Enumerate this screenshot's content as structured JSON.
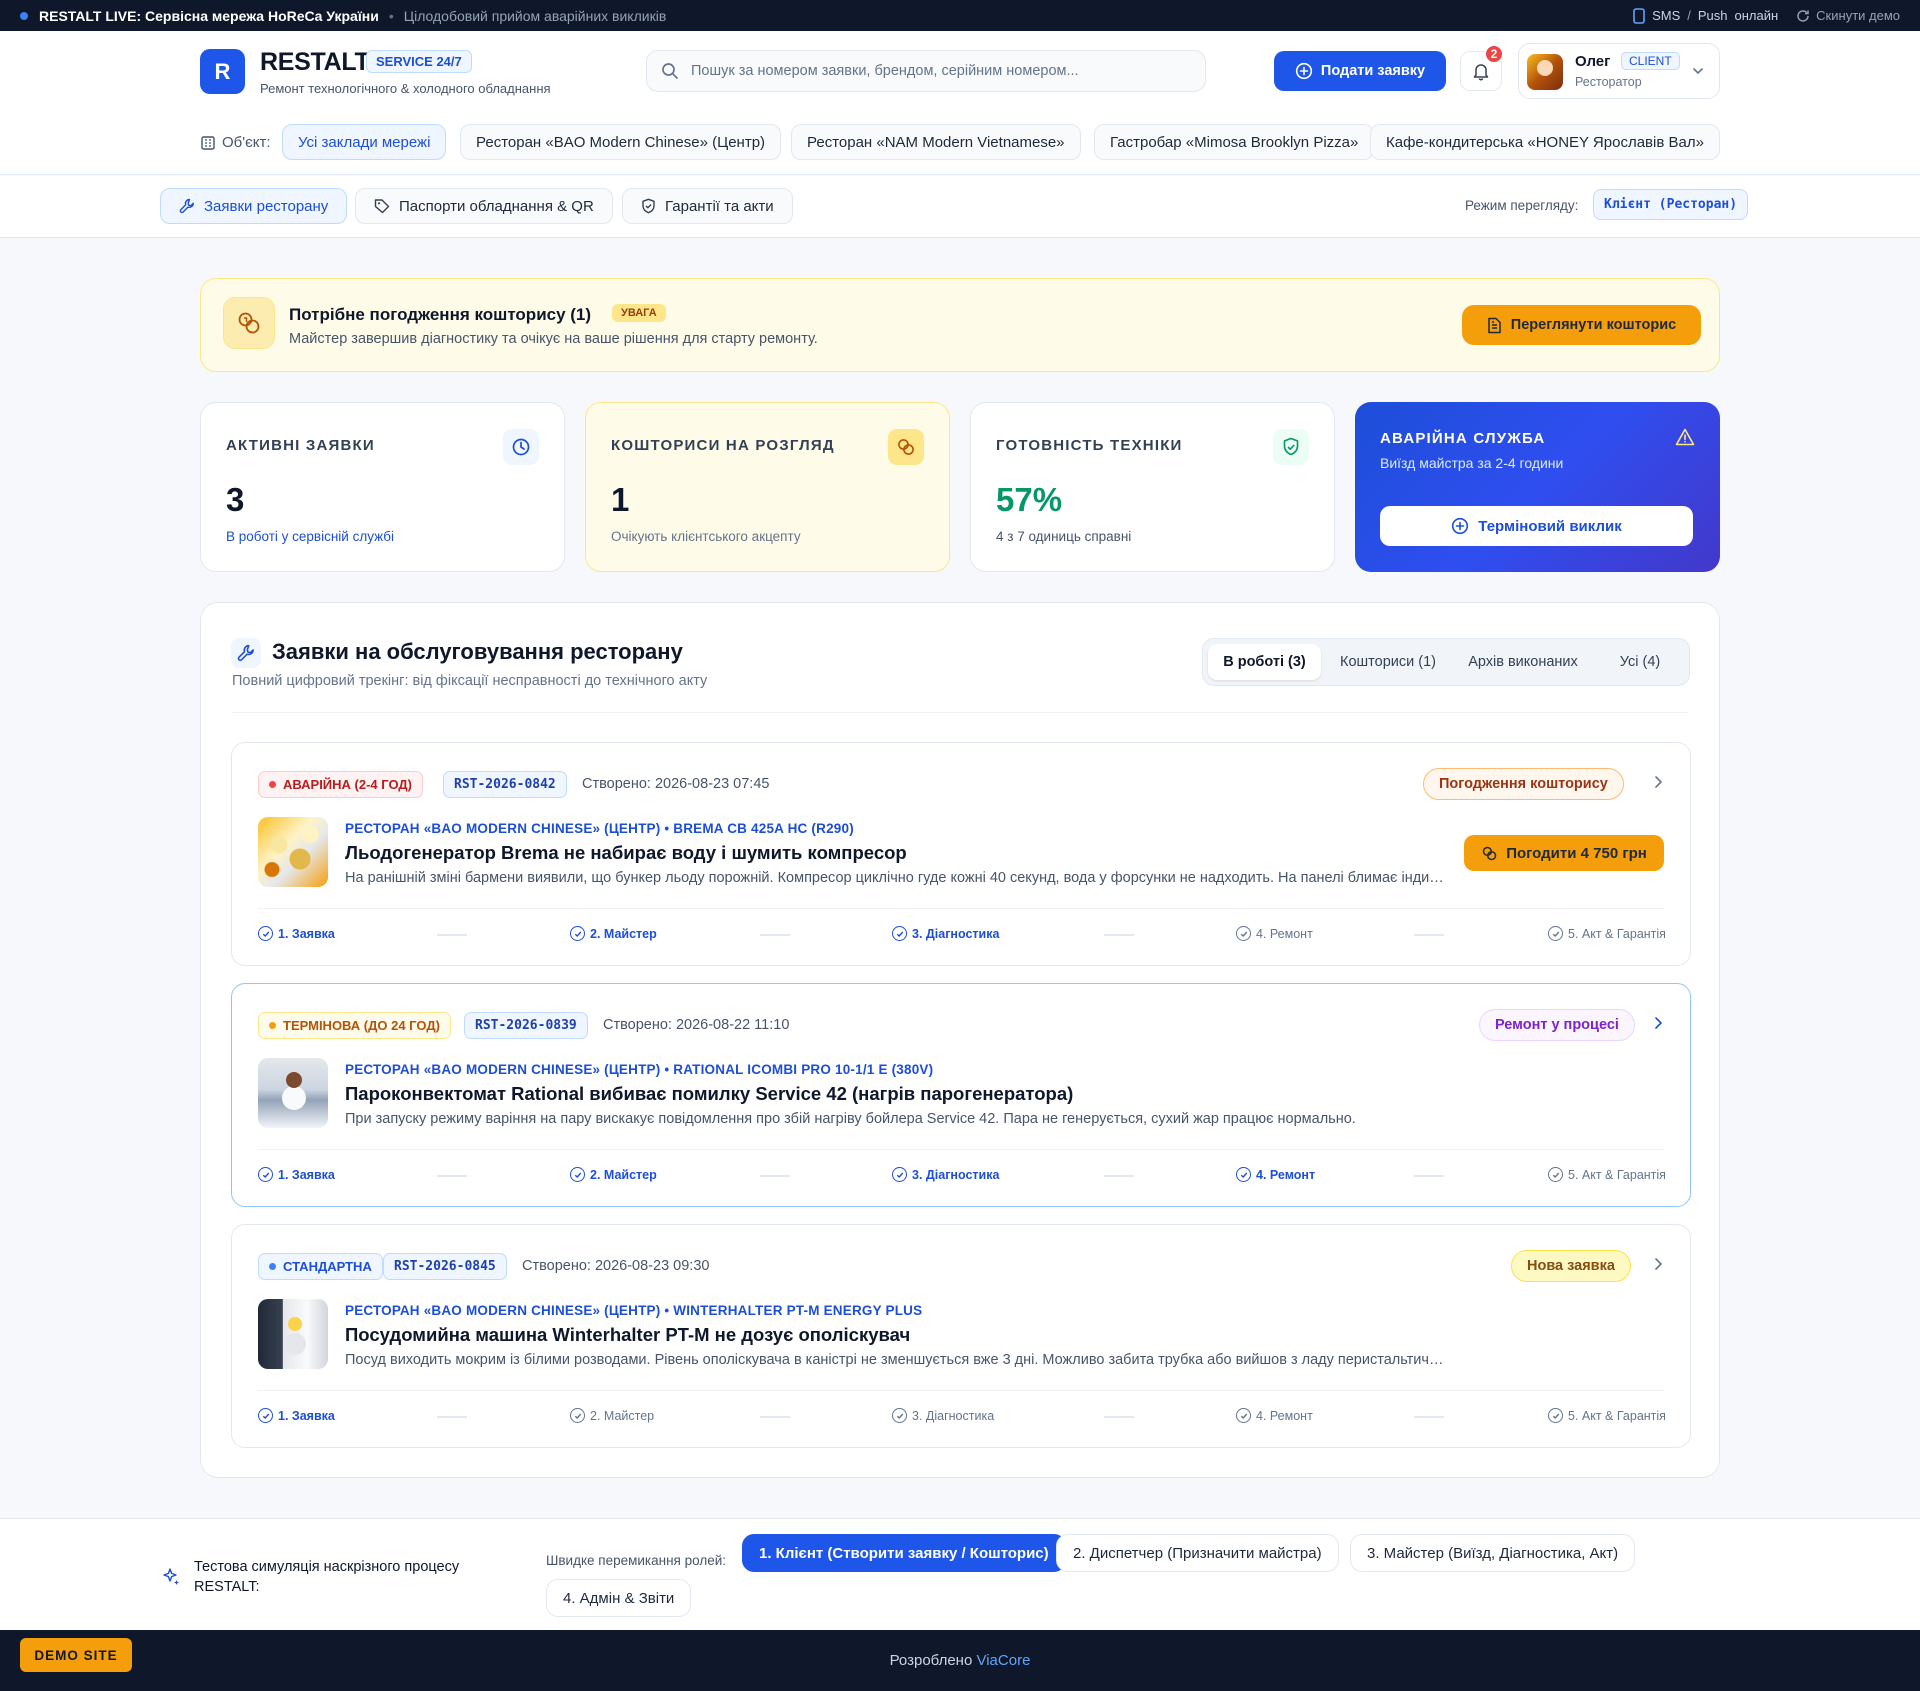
{
  "topbar": {
    "live": "RESTALT LIVE: Сервісна мережа HoReCa України",
    "sep": "•",
    "sub": "Цілодобовий прийом аварійних викликів",
    "sms": "SMS",
    "slash": "/",
    "push": "Push",
    "online": "онлайн",
    "reset": "Скинути демо"
  },
  "header": {
    "logo_letter": "R",
    "brand": "RESTALT",
    "brand_tag": "SERVICE 24/7",
    "brand_sub": "Ремонт технологічного & холодного обладнання",
    "search_placeholder": "Пошук за номером заявки, брендом, серійним номером...",
    "submit_label": "Подати заявку",
    "notifications_count": "2",
    "user": {
      "name": "Олег",
      "tag": "CLIENT",
      "role": "Ресторатор"
    },
    "object_label": "Об'єкт:",
    "objects": [
      "Усі заклади мережі",
      "Ресторан «BAO Modern Chinese» (Центр)",
      "Ресторан «NAM Modern Vietnamese»",
      "Гастробар «Mimosa Brooklyn Pizza»",
      "Кафе-кондитерська «HONEY Ярославів Вал»"
    ]
  },
  "nav": {
    "tabs": [
      "Заявки ресторану",
      "Паспорти обладнання & QR",
      "Гарантії та акти"
    ],
    "mode_label": "Режим перегляду:",
    "mode_value": "Клієнт (Ресторан)"
  },
  "alert": {
    "title": "Потрібне погодження кошторису (1)",
    "badge": "УВАГА",
    "desc": "Майстер завершив діагностику та очікує на ваше рішення для старту ремонту.",
    "button": "Переглянути кошторис"
  },
  "stats": [
    {
      "label": "АКТИВНІ ЗАЯВКИ",
      "value": "3",
      "note": "В роботі у сервісній службі"
    },
    {
      "label": "КОШТОРИСИ НА РОЗГЛЯД",
      "value": "1",
      "note": "Очікують клієнтського акцепту"
    },
    {
      "label": "ГОТОВНІСТЬ ТЕХНІКИ",
      "value": "57%",
      "note": "4 з 7 одиниць справні"
    },
    {
      "label": "АВАРІЙНА СЛУЖБА",
      "note": "Виїзд майстра за 2-4 години",
      "button": "Терміновий виклик"
    }
  ],
  "colors": {
    "accent": "#1d56e8",
    "amber": "#f59e0b",
    "success": "#059669",
    "danger": "#ef4444"
  },
  "main": {
    "title": "Заявки на обслуговування ресторану",
    "subtitle": "Повний цифровий трекінг: від фіксації несправності до технічного акту",
    "filters": [
      "В роботі (3)",
      "Кошториси (1)",
      "Архів виконаних",
      "Усі (4)"
    ],
    "steps": [
      "1. Заявка",
      "2. Майстер",
      "3. Діагностика",
      "4. Ремонт",
      "5. Акт & Гарантія"
    ],
    "tickets": [
      {
        "priority": "АВАРІЙНА (2-4 ГОД)",
        "id": "RST-2026-0842",
        "created": "Створено: 2026-08-23 07:45",
        "status": "Погодження кошторису",
        "meta": "Ресторан «BAO Modern Chinese» (Центр) • BREMA CB 425A HC (R290)",
        "title": "Льодогенератор Brema не набирає воду і шумить компресор",
        "desc": "На ранішній зміні бармени виявили, що бункер льоду порожній. Компресор циклічно гуде кожні 40 секунд, вода у форсунки не надходить. На панелі блимає індикатор.",
        "action": "Погодити 4 750 грн",
        "steps_done": 3
      },
      {
        "priority": "ТЕРМІНОВА (ДО 24 ГОД)",
        "id": "RST-2026-0839",
        "created": "Створено: 2026-08-22 11:10",
        "status": "Ремонт у процесі",
        "meta": "Ресторан «BAO Modern Chinese» (Центр) • RATIONAL ICOMBI PRO 10-1/1 E (380V)",
        "title": "Пароконвектомат Rational вибиває помилку Service 42 (нагрів парогенератора)",
        "desc": "При запуску режиму варіння на пару вискакує повідомлення про збій нагріву бойлера Service 42. Пара не генерується, сухий жар працює нормально.",
        "steps_done": 4
      },
      {
        "priority": "СТАНДАРТНА",
        "id": "RST-2026-0845",
        "created": "Створено: 2026-08-23 09:30",
        "status": "Нова заявка",
        "meta": "Ресторан «BAO Modern Chinese» (Центр) • WINTERHALTER PT-M ENERGY PLUS",
        "title": "Посудомийна машина Winterhalter PT-M не дозує ополіскувач",
        "desc": "Посуд виходить мокрим із білими розводами. Рівень ополіскувача в каністрі не зменшується вже 3 дні. Можливо забита трубка або вийшов з ладу перистальтичний дозатор.",
        "steps_done": 1
      }
    ]
  },
  "sim": {
    "title": "Тестова симуляція наскрізного процесу RESTALT:",
    "roles_label": "Швидке перемикання ролей:",
    "roles": [
      "1. Клієнт (Створити заявку / Кошторис)",
      "2. Диспетчер (Призначити майстра)",
      "3. Майстер (Виїзд, Діагностика, Акт)",
      "4. Адмін & Звіти"
    ]
  },
  "footer": {
    "demo": "DEMO SITE",
    "credit_prefix": "Розроблено",
    "credit_link": "ViaCore"
  }
}
